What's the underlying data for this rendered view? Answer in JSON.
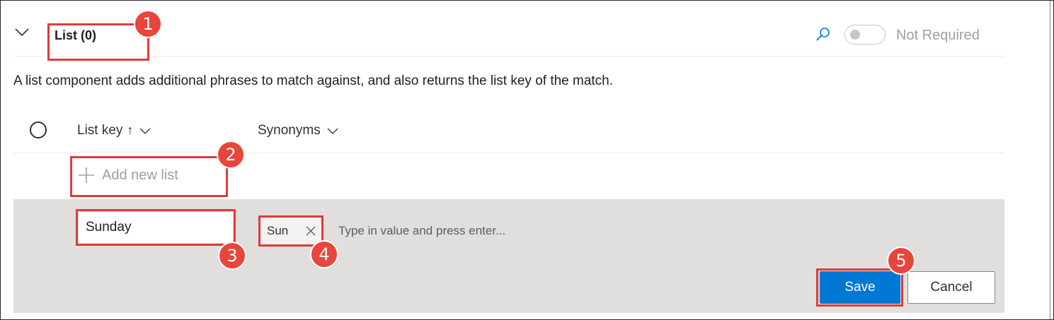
{
  "section": {
    "title": "List (0)",
    "required_toggle_label": "Not Required",
    "required_toggle_on": false,
    "description": "A list component adds additional phrases to match against, and also returns the list key of the match."
  },
  "columns": {
    "list_key": "List key",
    "sort_indicator": "↑",
    "synonyms": "Synonyms"
  },
  "add_new_list_label": "Add new list",
  "edit_row": {
    "list_key_value": "Sunday",
    "synonym_chips": [
      "Sun"
    ],
    "synonym_placeholder": "Type in value and press enter...",
    "save_label": "Save",
    "cancel_label": "Cancel"
  },
  "annotations": [
    "1",
    "2",
    "3",
    "4",
    "5"
  ],
  "colors": {
    "accent": "#0078d4",
    "annotation": "#e8453c",
    "edit_row_bg": "#e1dfdd"
  }
}
